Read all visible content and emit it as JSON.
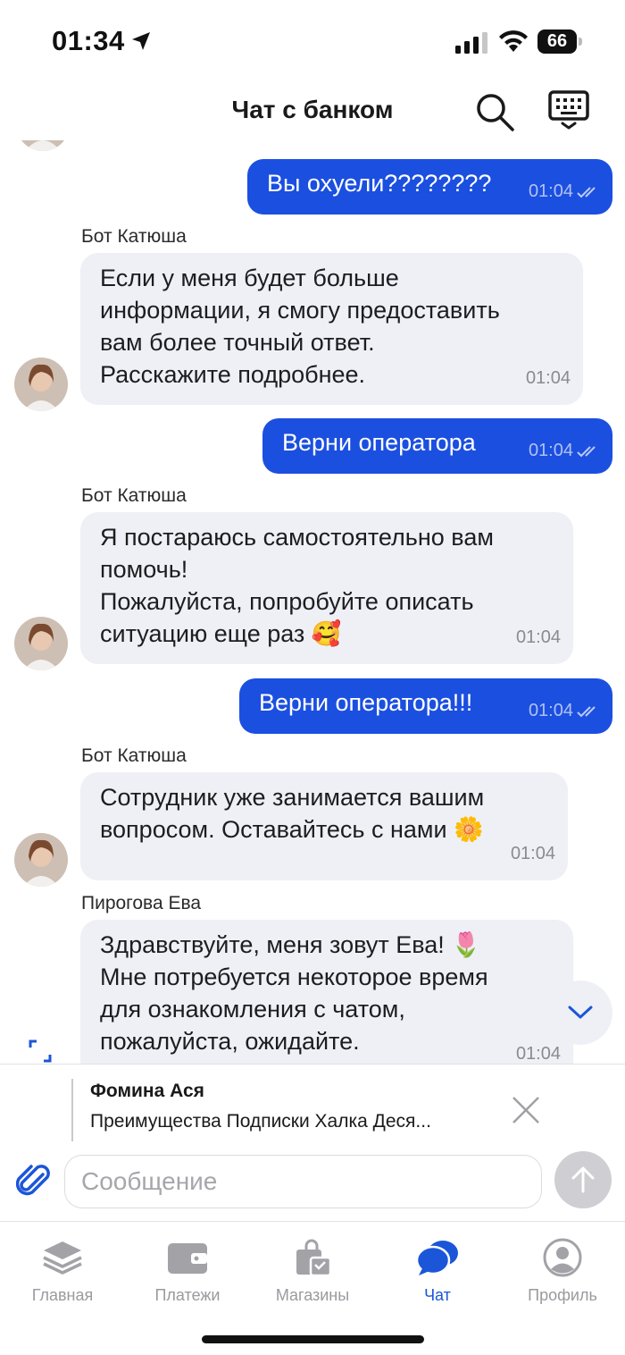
{
  "status": {
    "time": "01:34",
    "battery": "66"
  },
  "header": {
    "title": "Чат с банком"
  },
  "messages": [
    {
      "id": "m1",
      "dir": "out",
      "text": "Вы охуели????????",
      "time": "01:04"
    },
    {
      "id": "m2",
      "dir": "in",
      "sender": "Бот Катюша",
      "text": "Если у меня будет больше\nинформации, я смогу предоставить\nвам более точный ответ.\nРасскажите подробнее.",
      "time": "01:04"
    },
    {
      "id": "m3",
      "dir": "out",
      "text": "Верни оператора",
      "time": "01:04"
    },
    {
      "id": "m4",
      "dir": "in",
      "sender": "Бот Катюша",
      "text": "Я постараюсь самостоятельно вам\nпомочь!\nПожалуйста, попробуйте описать\nситуацию еще раз 🥰",
      "time": "01:04"
    },
    {
      "id": "m5",
      "dir": "out",
      "text": "Верни оператора!!!",
      "time": "01:04"
    },
    {
      "id": "m6",
      "dir": "in",
      "sender": "Бот Катюша",
      "text": "Сотрудник уже занимается вашим\nвопросом. Оставайтесь с нами 🌼",
      "time": "01:04"
    },
    {
      "id": "m7",
      "dir": "in",
      "sender": "Пирогова Ева",
      "text": "Здравствуйте, меня зовут Ева! 🌷\nМне потребуется некоторое время\nдля ознакомления с чатом,\nпожалуйста, ожидайте.",
      "time": "01:04"
    }
  ],
  "reply": {
    "name": "Фомина Ася",
    "text": "Преимущества Подписки Халка Деся..."
  },
  "input": {
    "placeholder": "Сообщение"
  },
  "tabs": [
    {
      "label": "Главная",
      "icon": "layers-icon"
    },
    {
      "label": "Платежи",
      "icon": "wallet-icon"
    },
    {
      "label": "Магазины",
      "icon": "shopping-bag-icon"
    },
    {
      "label": "Чат",
      "icon": "chat-bubbles-icon",
      "active": true
    },
    {
      "label": "Профиль",
      "icon": "profile-icon"
    }
  ],
  "colors": {
    "accent": "#1b4fe0",
    "incoming_bubble": "#eef0f5",
    "tab_active": "#1b56d8",
    "tab_inactive": "#9a9a9f"
  }
}
